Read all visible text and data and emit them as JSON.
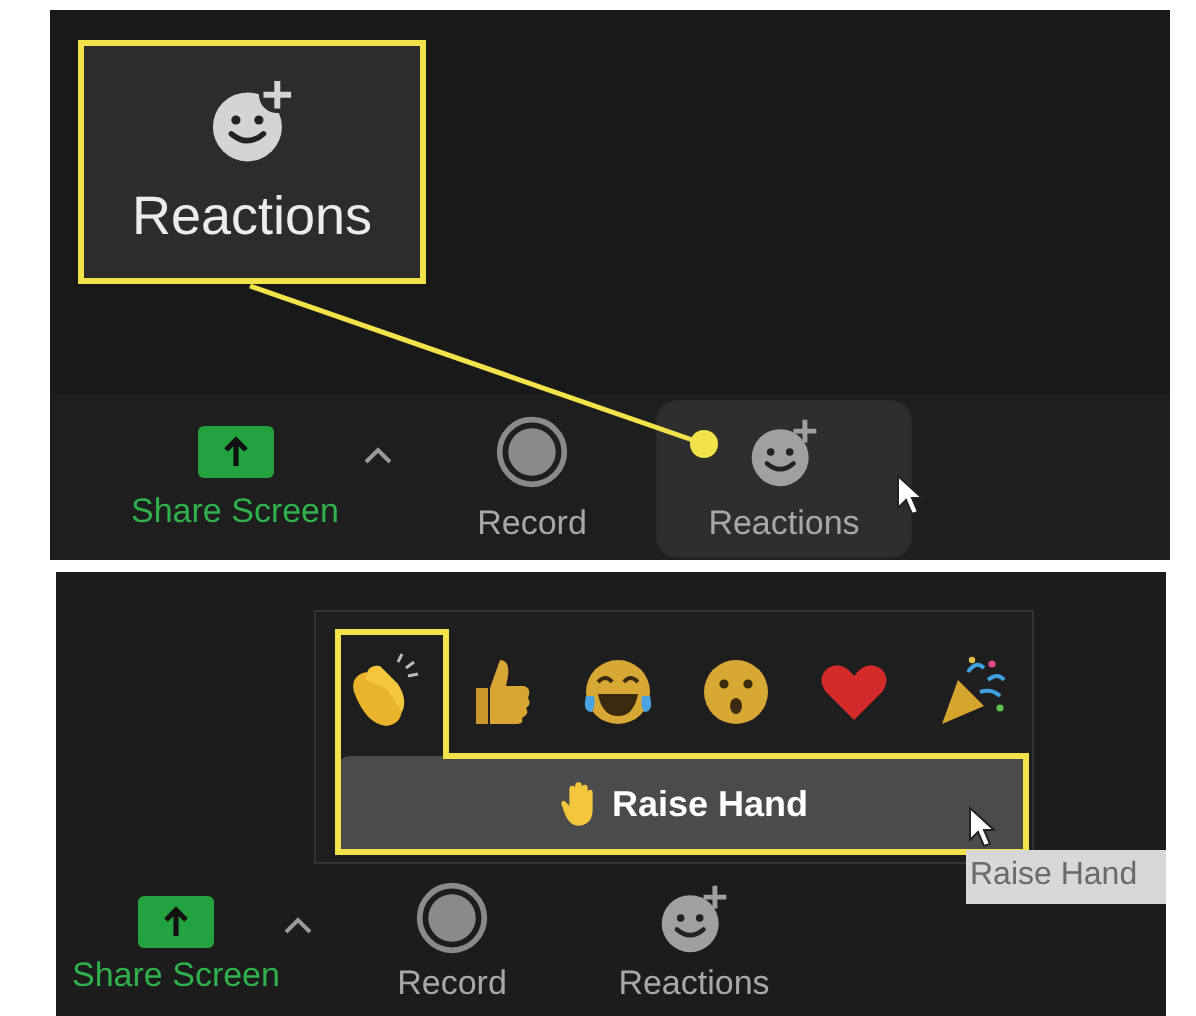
{
  "top_panel": {
    "callout": {
      "label": "Reactions"
    },
    "toolbar": [
      {
        "kind": "share",
        "label": "Share Screen",
        "hovered": false
      },
      {
        "kind": "record",
        "label": "Record",
        "hovered": false
      },
      {
        "kind": "reactions",
        "label": "Reactions",
        "hovered": true
      }
    ]
  },
  "bottom_panel": {
    "reactions_popup": {
      "emojis": [
        {
          "kind": "clap"
        },
        {
          "kind": "thumbs"
        },
        {
          "kind": "laugh"
        },
        {
          "kind": "wow"
        },
        {
          "kind": "heart"
        },
        {
          "kind": "party"
        }
      ],
      "raise_hand_button": "Raise Hand"
    },
    "tooltip": "Raise Hand",
    "toolbar": [
      {
        "kind": "share",
        "label": "Share Screen",
        "hovered": false
      },
      {
        "kind": "record",
        "label": "Record",
        "hovered": false
      },
      {
        "kind": "reactions",
        "label": "Reactions",
        "hovered": false
      }
    ]
  }
}
